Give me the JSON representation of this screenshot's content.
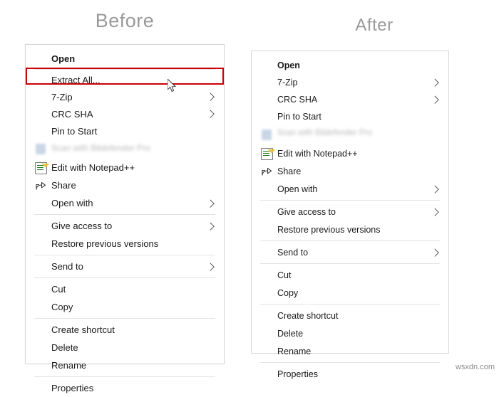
{
  "headings": {
    "before": "Before",
    "after": "After"
  },
  "watermark": "wsxdn.com",
  "before_menu": {
    "items": [
      {
        "label": "Open",
        "bold": true,
        "chevron": false,
        "icon": "none"
      },
      {
        "label": "Extract All...",
        "bold": false,
        "chevron": false,
        "icon": "none",
        "highlighted": true
      },
      {
        "label": "7-Zip",
        "bold": false,
        "chevron": true,
        "icon": "none"
      },
      {
        "label": "CRC SHA",
        "bold": false,
        "chevron": true,
        "icon": "none"
      },
      {
        "label": "Pin to Start",
        "bold": false,
        "chevron": false,
        "icon": "none"
      },
      {
        "label": "Scan with Bitdefender Pro",
        "bold": false,
        "chevron": false,
        "icon": "shield-icon",
        "blurred": true
      },
      {
        "label": "Edit with Notepad++",
        "bold": false,
        "chevron": false,
        "icon": "notepad-icon"
      },
      {
        "label": "Share",
        "bold": false,
        "chevron": false,
        "icon": "share-icon"
      },
      {
        "label": "Open with",
        "bold": false,
        "chevron": true,
        "icon": "none"
      },
      {
        "label": "Give access to",
        "bold": false,
        "chevron": true,
        "icon": "none"
      },
      {
        "label": "Restore previous versions",
        "bold": false,
        "chevron": false,
        "icon": "none"
      },
      {
        "label": "Send to",
        "bold": false,
        "chevron": true,
        "icon": "none"
      },
      {
        "label": "Cut",
        "bold": false,
        "chevron": false,
        "icon": "none"
      },
      {
        "label": "Copy",
        "bold": false,
        "chevron": false,
        "icon": "none"
      },
      {
        "label": "Create shortcut",
        "bold": false,
        "chevron": false,
        "icon": "none"
      },
      {
        "label": "Delete",
        "bold": false,
        "chevron": false,
        "icon": "none"
      },
      {
        "label": "Rename",
        "bold": false,
        "chevron": false,
        "icon": "none"
      },
      {
        "label": "Properties",
        "bold": false,
        "chevron": false,
        "icon": "none"
      }
    ]
  },
  "after_menu": {
    "items": [
      {
        "label": "Open",
        "bold": true,
        "chevron": false,
        "icon": "none"
      },
      {
        "label": "7-Zip",
        "bold": false,
        "chevron": true,
        "icon": "none"
      },
      {
        "label": "CRC SHA",
        "bold": false,
        "chevron": true,
        "icon": "none"
      },
      {
        "label": "Pin to Start",
        "bold": false,
        "chevron": false,
        "icon": "none"
      },
      {
        "label": "Scan with Bitdefender Pro",
        "bold": false,
        "chevron": false,
        "icon": "shield-icon",
        "blurred": true
      },
      {
        "label": "Edit with Notepad++",
        "bold": false,
        "chevron": false,
        "icon": "notepad-icon"
      },
      {
        "label": "Share",
        "bold": false,
        "chevron": false,
        "icon": "share-icon"
      },
      {
        "label": "Open with",
        "bold": false,
        "chevron": true,
        "icon": "none"
      },
      {
        "label": "Give access to",
        "bold": false,
        "chevron": true,
        "icon": "none"
      },
      {
        "label": "Restore previous versions",
        "bold": false,
        "chevron": false,
        "icon": "none"
      },
      {
        "label": "Send to",
        "bold": false,
        "chevron": true,
        "icon": "none"
      },
      {
        "label": "Cut",
        "bold": false,
        "chevron": false,
        "icon": "none"
      },
      {
        "label": "Copy",
        "bold": false,
        "chevron": false,
        "icon": "none"
      },
      {
        "label": "Create shortcut",
        "bold": false,
        "chevron": false,
        "icon": "none"
      },
      {
        "label": "Delete",
        "bold": false,
        "chevron": false,
        "icon": "none"
      },
      {
        "label": "Rename",
        "bold": false,
        "chevron": false,
        "icon": "none"
      },
      {
        "label": "Properties",
        "bold": false,
        "chevron": false,
        "icon": "none"
      }
    ]
  },
  "colors": {
    "highlight": "#cc0000",
    "heading": "#9a9a9a",
    "menu_border": "#d6d6d6",
    "separator": "#e3e3e3",
    "text": "#1a1a1a"
  }
}
